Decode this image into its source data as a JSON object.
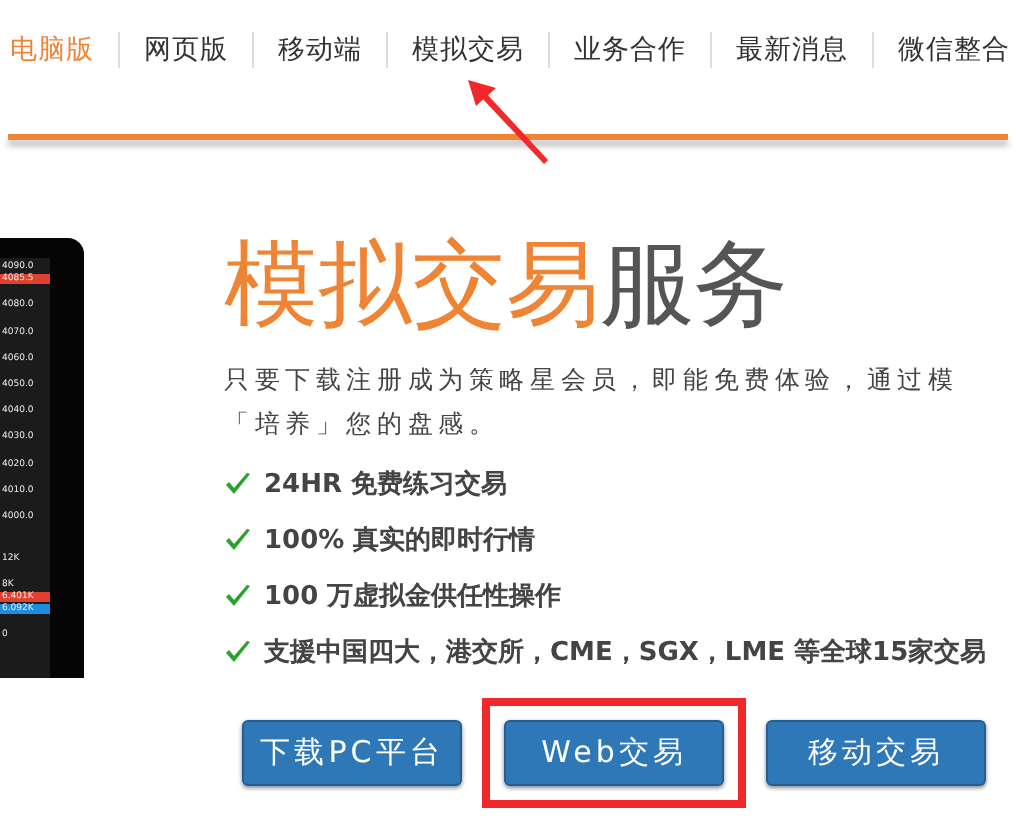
{
  "nav": [
    {
      "label": "电脑版",
      "selected": true
    },
    {
      "label": "网页版",
      "selected": false
    },
    {
      "label": "移动端",
      "selected": false
    },
    {
      "label": "模拟交易",
      "selected": false
    },
    {
      "label": "业务合作",
      "selected": false
    },
    {
      "label": "最新消息",
      "selected": false
    },
    {
      "label": "微信整合",
      "selected": false
    }
  ],
  "device": {
    "axis_labels": [
      {
        "text": "4090.0",
        "kind": "plain"
      },
      {
        "text": "4085.5",
        "kind": "sell"
      },
      {
        "text": "4080.0",
        "kind": "plain"
      },
      {
        "text": "4070.0",
        "kind": "plain"
      },
      {
        "text": "4060.0",
        "kind": "plain"
      },
      {
        "text": "4050.0",
        "kind": "plain"
      },
      {
        "text": "4040.0",
        "kind": "plain"
      },
      {
        "text": "4030.0",
        "kind": "plain"
      },
      {
        "text": "4020.0",
        "kind": "plain"
      },
      {
        "text": "4010.0",
        "kind": "plain"
      },
      {
        "text": "4000.0",
        "kind": "plain"
      }
    ],
    "volume_labels": [
      {
        "text": "12K",
        "kind": "plain"
      },
      {
        "text": "8K",
        "kind": "plain"
      },
      {
        "text": "6.401K",
        "kind": "sell"
      },
      {
        "text": "6.092K",
        "kind": "buy"
      },
      {
        "text": "0",
        "kind": "plain"
      }
    ]
  },
  "title": {
    "highlight": "模拟交易",
    "rest": "服务"
  },
  "intro": [
    "只要下载注册成为策略星会员，即能免费体验，通过模",
    "「培养」您的盘感。"
  ],
  "features": [
    "24HR 免费练习交易",
    "100% 真实的即时行情",
    "100 万虚拟金供任性操作",
    "支援中国四大，港交所，CME，SGX，LME 等全球15家交易"
  ],
  "buttons": [
    {
      "label": "下载PC平台",
      "highlighted": false
    },
    {
      "label": "Web交易",
      "highlighted": true
    },
    {
      "label": "移动交易",
      "highlighted": false
    }
  ]
}
